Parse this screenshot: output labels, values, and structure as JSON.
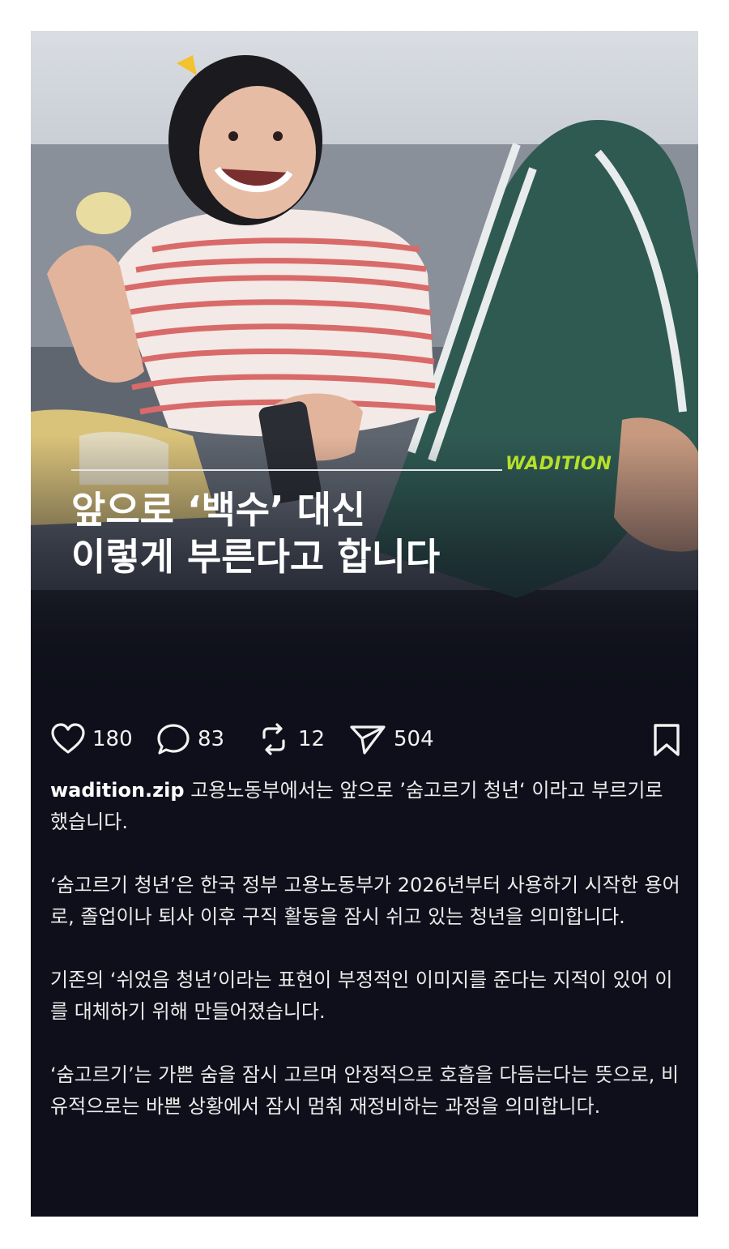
{
  "post": {
    "brand": "WADITION",
    "headline": [
      "앞으로 ‘백수’ 대신",
      "이렇게 부른다고 합니다"
    ],
    "accent_color": "#b6e12a",
    "actions": {
      "likes": "180",
      "comments": "83",
      "reposts": "12",
      "shares": "504"
    },
    "username": "wadition.zip",
    "caption_first": "고용노동부에서는 앞으로 ’숨고르기 청년‘ 이라고 부르기로 했습니다.",
    "paragraphs": [
      "‘숨고르기 청년’은 한국 정부 고용노동부가 2026년부터 사용하기 시작한 용어로, 졸업이나 퇴사 이후 구직 활동을 잠시 쉬고 있는 청년을 의미합니다.",
      "기존의 ‘쉬었음 청년’이라는 표현이 부정적인 이미지를 준다는 지적이 있어 이를 대체하기 위해 만들어졌습니다.",
      "‘숨고르기’는 가쁜 숨을 잠시 고르며 안정적으로 호흡을 다듬는다는 뜻으로, 비유적으로는 바쁜 상황에서 잠시 멈춰 재정비하는 과정을 의미합니다."
    ]
  }
}
